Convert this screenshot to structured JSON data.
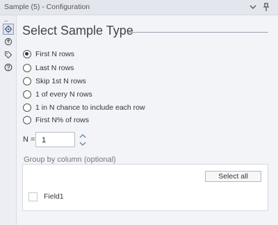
{
  "window": {
    "title": "Sample (5) - Configuration",
    "icons": [
      "chevron-down-icon",
      "pin-icon"
    ]
  },
  "rail": {
    "dots": "...",
    "icons": [
      "configuration-gear-icon",
      "connection-icon",
      "tag-icon",
      "help-icon"
    ],
    "active": "configuration-gear-icon"
  },
  "main": {
    "heading": "Select Sample Type",
    "options": [
      {
        "label": "First N rows",
        "checked": true
      },
      {
        "label": "Last N rows",
        "checked": false
      },
      {
        "label": "Skip 1st N rows",
        "checked": false
      },
      {
        "label": "1 of every N rows",
        "checked": false
      },
      {
        "label": "1 in N chance to include each row",
        "checked": false
      },
      {
        "label": "First N% of rows",
        "checked": false
      }
    ],
    "n_label": "N =",
    "n_value": "1",
    "group_label": "Group by column (optional)",
    "select_all_label": "Select all",
    "fields": [
      {
        "label": "Field1",
        "checked": false
      }
    ]
  },
  "colors": {
    "background": "#f3f4f8",
    "titlebar": "#e4e6ee",
    "active_rail_border": "#8a97b8"
  }
}
